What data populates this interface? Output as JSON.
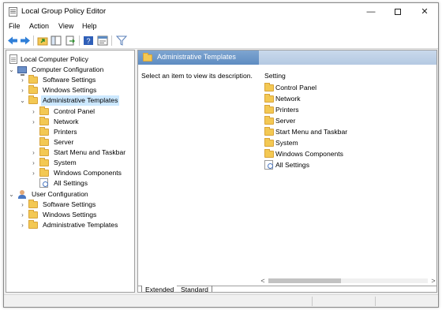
{
  "window": {
    "title": "Local Group Policy Editor",
    "controls": {
      "minimize": "—",
      "close": "✕"
    }
  },
  "menu": [
    "File",
    "Action",
    "View",
    "Help"
  ],
  "toolbar": {
    "icons": [
      "back-arrow-icon",
      "forward-arrow-icon",
      "up-folder-icon",
      "show-hide-tree-icon",
      "export-list-icon",
      "help-icon",
      "properties-icon",
      "filter-icon"
    ]
  },
  "tree": {
    "root": "Local Computer Policy",
    "computer_config": "Computer Configuration",
    "cc_software": "Software Settings",
    "cc_windows": "Windows Settings",
    "cc_admin": "Administrative Templates",
    "at_control_panel": "Control Panel",
    "at_network": "Network",
    "at_printers": "Printers",
    "at_server": "Server",
    "at_start_menu": "Start Menu and Taskbar",
    "at_system": "System",
    "at_windows_components": "Windows Components",
    "at_all_settings": "All Settings",
    "user_config": "User Configuration",
    "uc_software": "Software Settings",
    "uc_windows": "Windows Settings",
    "uc_admin": "Administrative Templates"
  },
  "right": {
    "header": "Administrative Templates",
    "description": "Select an item to view its description.",
    "column": "Setting",
    "items": [
      "Control Panel",
      "Network",
      "Printers",
      "Server",
      "Start Menu and Taskbar",
      "System",
      "Windows Components",
      "All Settings"
    ],
    "scroll_left": "<",
    "scroll_right": ">"
  },
  "tabs": {
    "extended": "Extended",
    "standard": "Standard"
  },
  "colors": {
    "header_blue": "#5e8cc2",
    "selection": "#cce8ff",
    "folder": "#f3c853"
  }
}
